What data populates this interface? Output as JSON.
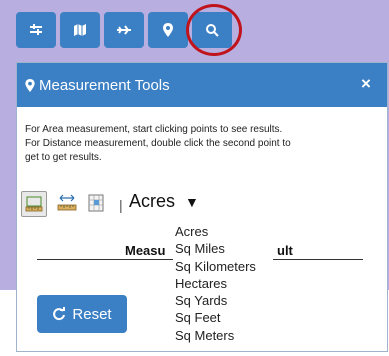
{
  "toolbar": {
    "buttons": [
      {
        "name": "layers-icon"
      },
      {
        "name": "map-icon"
      },
      {
        "name": "plane-icon"
      },
      {
        "name": "map-marker-icon"
      },
      {
        "name": "search-icon"
      }
    ]
  },
  "panel": {
    "title": "Measurement Tools",
    "close_label": "×",
    "instructions": [
      "For Area measurement, start clicking points to see results.",
      "For Distance measurement, double click the second point to",
      "get to get results."
    ],
    "selected_unit": "Acres",
    "unit_arrow": "▼",
    "separator": "|",
    "result_header_left": "Measu",
    "result_header_right": "ult",
    "unit_options": [
      "Acres",
      "Sq Miles",
      "Sq Kilometers",
      "Hectares",
      "Sq Yards",
      "Sq Feet",
      "Sq Meters"
    ],
    "reset_label": "Reset"
  },
  "colors": {
    "accent": "#3b7fc4",
    "highlight": "#c0141c",
    "background": "#b8aee0"
  }
}
